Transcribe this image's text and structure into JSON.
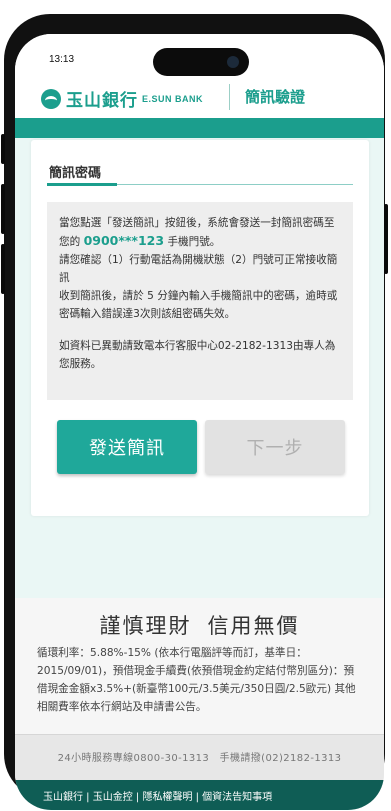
{
  "status_bar": {
    "time": "13:13"
  },
  "header": {
    "brand_zh": "玉山銀行",
    "brand_en": "E.SUN BANK",
    "page_title": "簡訊驗證"
  },
  "card": {
    "title": "簡訊密碼",
    "notice": {
      "line1_prefix": "當您點選「發送簡訊」按鈕後，系統會發送一封簡訊密碼至您的",
      "phone_number": "0900***123",
      "line1_suffix": "手機門號。",
      "line2": "請您確認（1）行動電話為開機狀態（2）門號可正常接收簡訊",
      "line3": "收到簡訊後，請於 5 分鐘內輸入手機簡訊中的密碼，逾時或密碼輸入錯誤達3次則該組密碼失效。",
      "line4": "如資料已異動請致電本行客服中心02-2182-1313由專人為您服務。"
    },
    "send_button": "發送簡訊",
    "next_button": "下一步"
  },
  "promo": {
    "slogan_part1": "謹慎理財",
    "slogan_part2": "信用無價",
    "text": "循環利率：5.88%-15% (依本行電腦評等而訂，基準日：2015/09/01)，預借現金手續費(依預借現金約定結付幣別區分)：預借現金金額x3.5%+(新臺幣100元/3.5美元/350日圓/2.5歐元) 其他相關費率依本行網站及申請書公告。"
  },
  "service": {
    "text": "24小時服務專線0800-30-1313　手機請撥(02)2182-1313"
  },
  "bottom_nav": {
    "text": "玉山銀行 | 玉山金控 | 隱私權聲明 | 個資法告知事項"
  },
  "colors": {
    "brand_teal": "#1b9e8d",
    "button_teal": "#1fa89a",
    "disabled_gray": "#e2e2e2",
    "footer_dark": "#0f5d55"
  }
}
